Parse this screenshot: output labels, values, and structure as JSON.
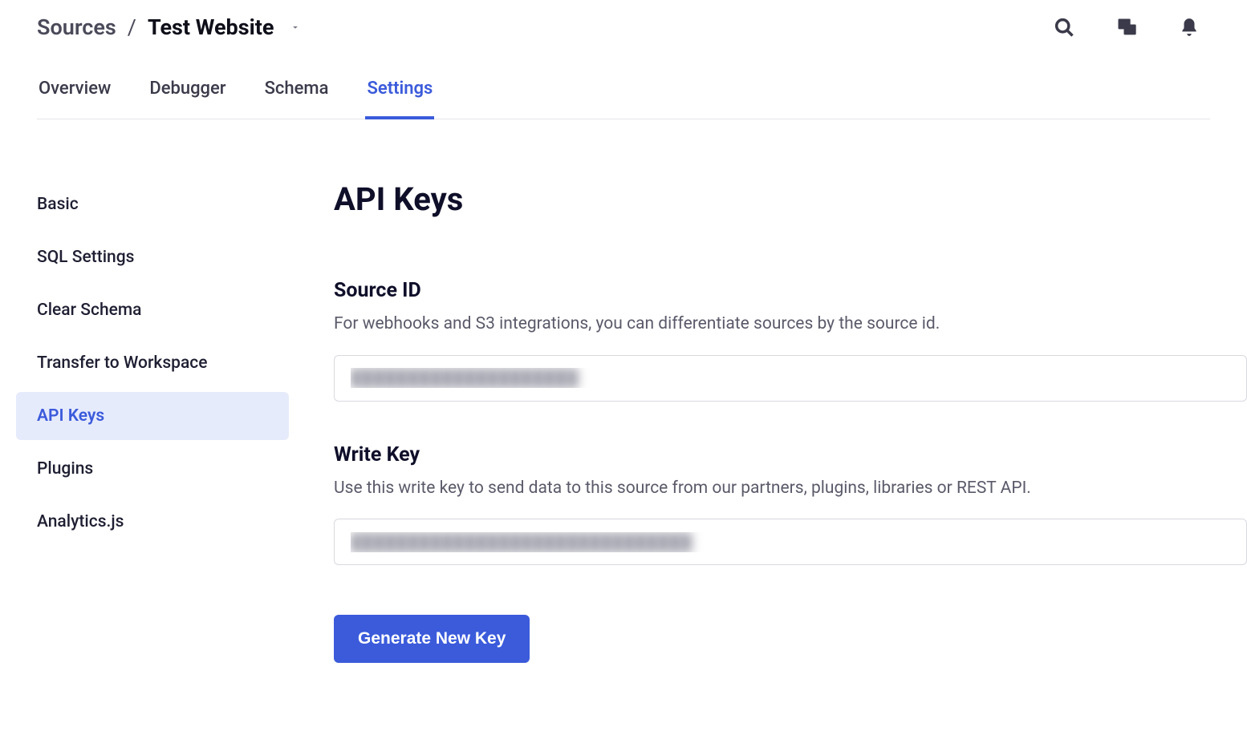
{
  "breadcrumb": {
    "parent": "Sources",
    "separator": "/",
    "current": "Test Website"
  },
  "tabs": [
    {
      "label": "Overview"
    },
    {
      "label": "Debugger"
    },
    {
      "label": "Schema"
    },
    {
      "label": "Settings"
    }
  ],
  "active_tab_index": 3,
  "sidebar": {
    "items": [
      {
        "label": "Basic"
      },
      {
        "label": "SQL Settings"
      },
      {
        "label": "Clear Schema"
      },
      {
        "label": "Transfer to Workspace"
      },
      {
        "label": "API Keys"
      },
      {
        "label": "Plugins"
      },
      {
        "label": "Analytics.js"
      }
    ],
    "active_index": 4
  },
  "main": {
    "title": "API Keys",
    "source_id": {
      "heading": "Source ID",
      "description": "For webhooks and S3 integrations, you can differentiate sources by the source id.",
      "value": "████████████████████"
    },
    "write_key": {
      "heading": "Write Key",
      "description": "Use this write key to send data to this source from our partners, plugins, libraries or REST API.",
      "value": "██████████████████████████████"
    },
    "generate_button": "Generate New Key"
  }
}
